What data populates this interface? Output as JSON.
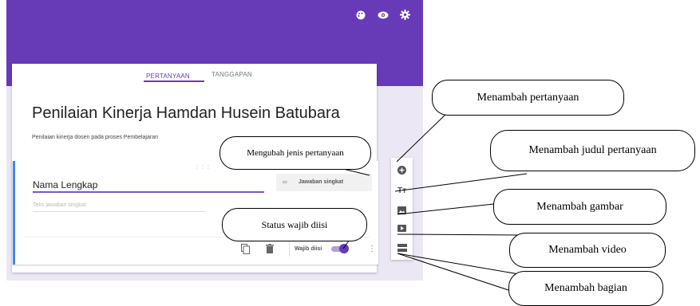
{
  "toolbar": {
    "icons": [
      "palette-icon",
      "eye-icon",
      "settings-icon"
    ]
  },
  "tabs": {
    "questions": "PERTANYAAN",
    "responses": "TANGGAPAN"
  },
  "form": {
    "title": "Penilaian Kinerja Hamdan Husein Batubara",
    "description": "Penilaian kinerja dosen pada proses Pembelajaran"
  },
  "question": {
    "title": "Nama Lengkap",
    "drag_handle": "⋮⋮⋮",
    "type_icon": "═",
    "type_label": "Jawaban singkat",
    "placeholder": "Teks jawaban singkat",
    "required_label": "Wajib diisi",
    "required": true
  },
  "side_toolbar": {
    "icons": [
      "add-question-icon",
      "add-title-icon",
      "add-image-icon",
      "add-video-icon",
      "add-section-icon"
    ]
  },
  "callouts": {
    "add_question": "Menambah pertanyaan",
    "change_type": "Mengubah jenis pertanyaan",
    "add_title": "Menambah judul pertanyaan",
    "add_image": "Menambah gambar",
    "required_status": "Status wajib diisi",
    "add_video": "Menambah video",
    "add_section": "Menambah bagian"
  },
  "colors": {
    "header": "#673ab7",
    "background": "#ece7f5",
    "accent": "#4285f4"
  }
}
